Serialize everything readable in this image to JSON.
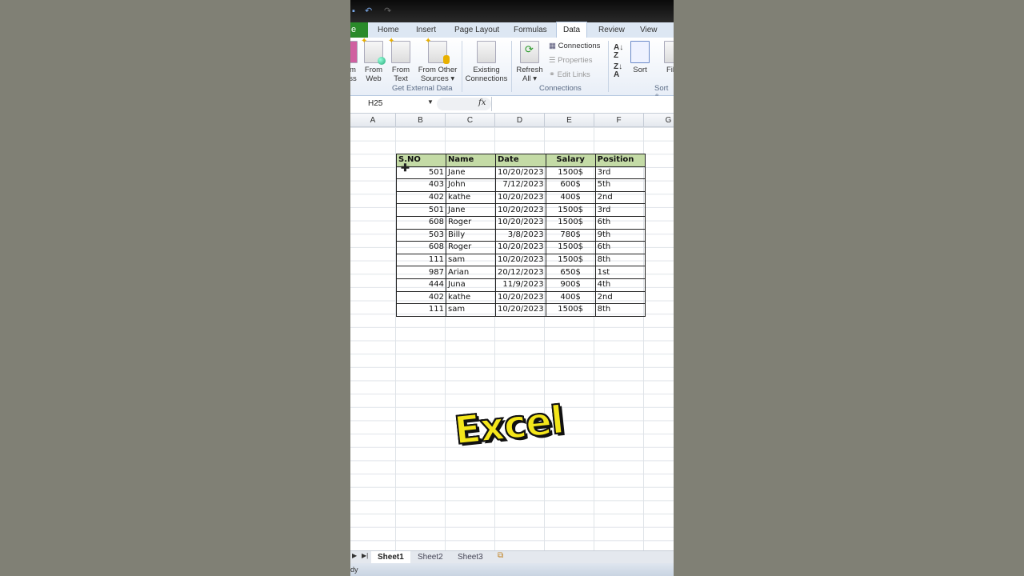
{
  "ribbon": {
    "tabs": [
      "Home",
      "Insert",
      "Page Layout",
      "Formulas",
      "Data",
      "Review",
      "View"
    ],
    "file_tab_label": "e",
    "active_tab": "Data",
    "get_external_data": {
      "access_label": "m\nss",
      "from_web": "From\nWeb",
      "from_text": "From\nText",
      "from_other": "From Other\nSources ▾",
      "group_label": "Get External Data"
    },
    "existing_connections": "Existing\nConnections",
    "connections": {
      "refresh_all": "Refresh\nAll ▾",
      "connections": "Connections",
      "properties": "Properties",
      "edit_links": "Edit Links",
      "group_label": "Connections"
    },
    "sort_filter": {
      "sort": "Sort",
      "filter": "Fil",
      "group_label": "Sort &"
    }
  },
  "formula_bar": {
    "name_box": "H25",
    "fx": "fx",
    "value": ""
  },
  "columns": [
    "A",
    "B",
    "C",
    "D",
    "E",
    "F",
    "G"
  ],
  "table": {
    "headers": [
      "S.NO",
      "Name",
      "Date",
      "Salary",
      "Position"
    ],
    "rows": [
      [
        "501",
        "Jane",
        "10/20/2023",
        "1500$",
        "3rd"
      ],
      [
        "403",
        "John",
        "7/12/2023",
        "600$",
        "5th"
      ],
      [
        "402",
        "kathe",
        "10/20/2023",
        "400$",
        "2nd"
      ],
      [
        "501",
        "Jane",
        "10/20/2023",
        "1500$",
        "3rd"
      ],
      [
        "608",
        "Roger",
        "10/20/2023",
        "1500$",
        "6th"
      ],
      [
        "503",
        "Billy",
        "3/8/2023",
        "780$",
        "9th"
      ],
      [
        "608",
        "Roger",
        "10/20/2023",
        "1500$",
        "6th"
      ],
      [
        "111",
        "sam",
        "10/20/2023",
        "1500$",
        "8th"
      ],
      [
        "987",
        "Arian",
        "20/12/2023",
        "650$",
        "1st"
      ],
      [
        "444",
        "Juna",
        "11/9/2023",
        "900$",
        "4th"
      ],
      [
        "402",
        "kathe",
        "10/20/2023",
        "400$",
        "2nd"
      ],
      [
        "111",
        "sam",
        "10/20/2023",
        "1500$",
        "8th"
      ]
    ]
  },
  "caption": "Excel",
  "sheets": [
    "Sheet1",
    "Sheet2",
    "Sheet3"
  ],
  "active_sheet": "Sheet1",
  "status": "dy"
}
